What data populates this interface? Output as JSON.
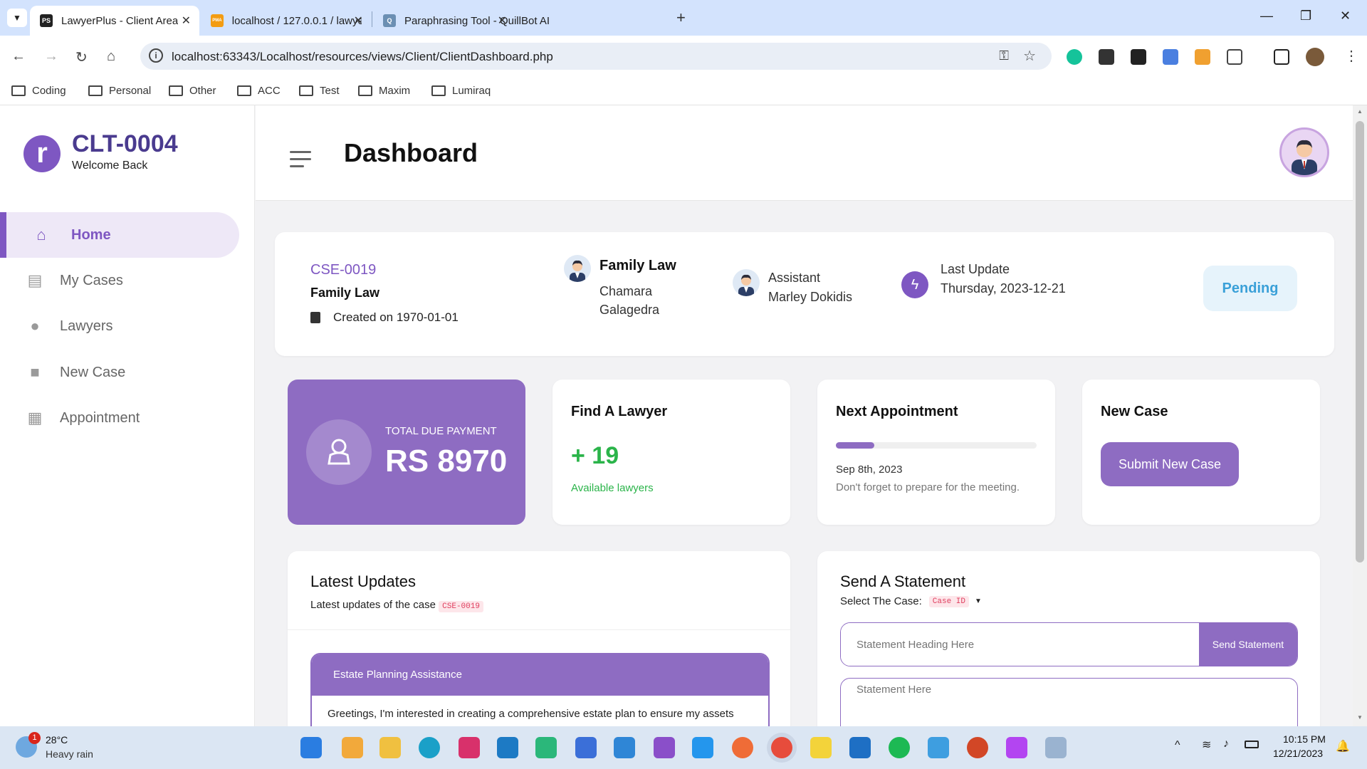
{
  "browser": {
    "tabs": [
      {
        "title": "LawyerPlus - Client Area",
        "favicon": "PS"
      },
      {
        "title": "localhost / 127.0.0.1 / lawyerplu",
        "favicon": "PMA"
      },
      {
        "title": "Paraphrasing Tool - QuillBot AI",
        "favicon": "Q"
      }
    ],
    "url": "localhost:63343/Localhost/resources/views/Client/ClientDashboard.php",
    "bookmarks": [
      "Coding",
      "Personal",
      "Other",
      "ACC",
      "Test",
      "Maxim",
      "Lumiraq"
    ]
  },
  "sidebar": {
    "logo_letter": "r",
    "client_id": "CLT-0004",
    "welcome": "Welcome Back",
    "items": [
      {
        "label": "Home",
        "icon": "home-icon",
        "active": true
      },
      {
        "label": "My Cases",
        "icon": "clipboard-icon"
      },
      {
        "label": "Lawyers",
        "icon": "person-icon"
      },
      {
        "label": "New Case",
        "icon": "note-icon"
      },
      {
        "label": "Appointment",
        "icon": "calendar-icon"
      }
    ]
  },
  "header": {
    "title": "Dashboard"
  },
  "case": {
    "id": "CSE-0019",
    "type": "Family Law",
    "created": "Created on 1970-01-01",
    "lawyer_title": "Family Law",
    "lawyer_name_1": "Chamara",
    "lawyer_name_2": "Galagedra",
    "assistant_label": "Assistant",
    "assistant_name": "Marley Dokidis",
    "last_update_label": "Last Update",
    "last_update_value": "Thursday, 2023-12-21",
    "status": "Pending"
  },
  "payment": {
    "label": "TOTAL DUE PAYMENT",
    "amount": "RS 8970"
  },
  "find_lawyer": {
    "title": "Find A Lawyer",
    "count": "+ 19",
    "sub": "Available lawyers"
  },
  "appointment": {
    "title": "Next Appointment",
    "progress": 0.19,
    "date": "Sep 8th, 2023",
    "note": "Don't forget to prepare for the meeting."
  },
  "new_case": {
    "title": "New Case",
    "button": "Submit New Case"
  },
  "updates": {
    "title": "Latest Updates",
    "sub": "Latest updates of the case",
    "case_badge": "CSE-0019",
    "item_title": "Estate Planning Assistance",
    "item_body": "Greetings, I'm interested in creating a comprehensive estate plan to ensure my assets"
  },
  "statement": {
    "title": "Send A Statement",
    "select_label": "Select The Case:",
    "select_value": "Case ID",
    "heading_placeholder": "Statement Heading Here",
    "send_button": "Send Statement",
    "body_placeholder": "Statement Here"
  },
  "taskbar": {
    "weather_temp": "28°C",
    "weather_desc": "Heavy rain",
    "weather_badge": "1",
    "time": "10:15 PM",
    "date": "12/21/2023"
  },
  "colors": {
    "accent": "#8e6cc2",
    "pending": "#3aa0d8",
    "green": "#2bb44a"
  }
}
